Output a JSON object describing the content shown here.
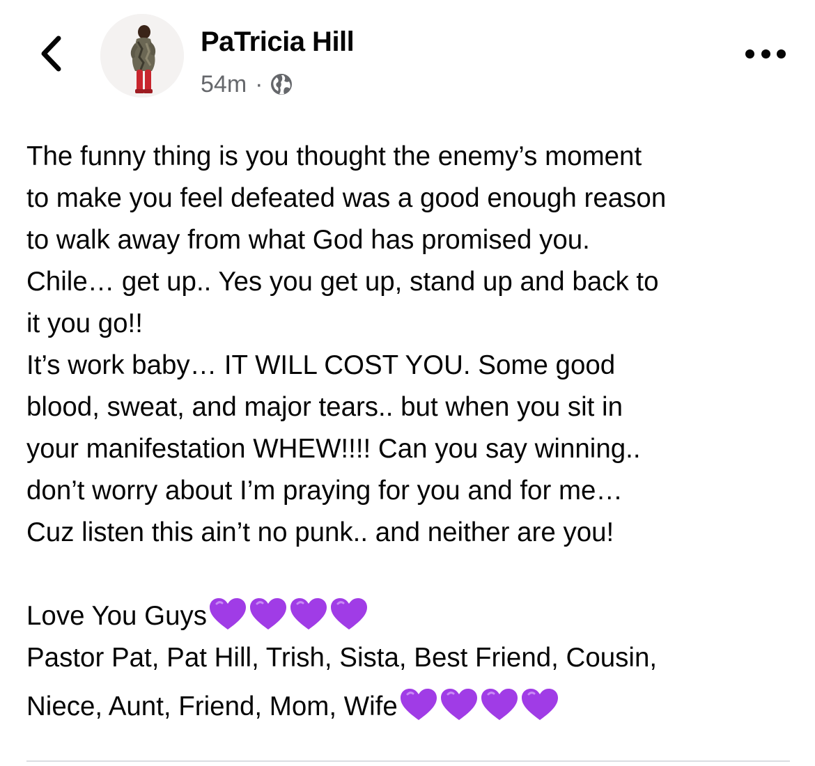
{
  "post": {
    "author": "PaTricia Hill",
    "time": "54m",
    "separator": "·",
    "audience_icon": "globe-icon",
    "lines": [
      "The funny thing is you thought the enemy’s moment",
      "to make you feel defeated was a good enough reason",
      "to walk away from what God has promised you.",
      "Chile… get up.. Yes you get up, stand up and back to",
      "it you go!!",
      "It’s work baby… IT WILL COST YOU. Some good",
      "blood, sweat, and major tears.. but when you sit in",
      "your manifestation WHEW!!!! Can you say winning..",
      "don’t worry about I’m praying for you and for me…",
      "Cuz listen this ain’t no punk.. and neither are you!"
    ],
    "signoff": "Love You Guys",
    "names_line1": "Pastor Pat, Pat Hill, Trish, Sista, Best Friend, Cousin,",
    "names_line2": "Niece, Aunt, Friend, Mom, Wife",
    "heart_emoji": "purple-heart",
    "heart_color": "#a03ce6",
    "heart_count_per_group": 4
  },
  "colors": {
    "text": "#050505",
    "meta": "#65676b",
    "divider": "#dadde1"
  },
  "icons": {
    "back": "chevron-left-icon",
    "more": "more-horizontal-icon",
    "audience": "globe-icon"
  }
}
